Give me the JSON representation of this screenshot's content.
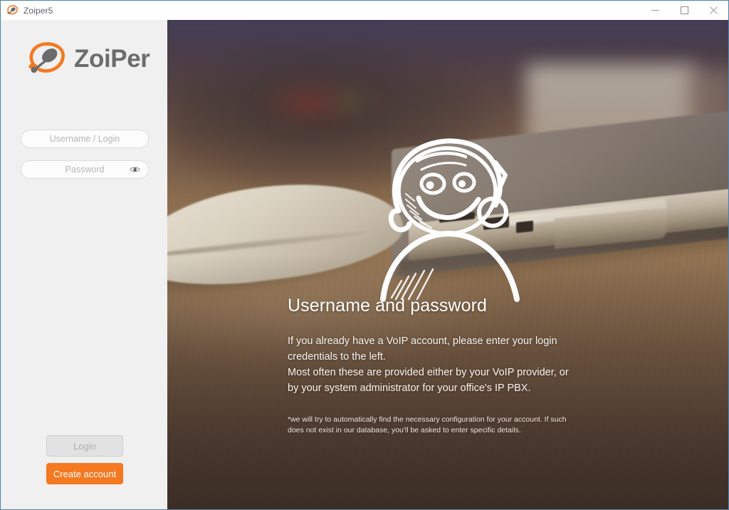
{
  "window": {
    "title": "Zoiper5",
    "app_icon": "zoiper-headset-icon",
    "controls": {
      "minimize": "minimize-icon",
      "maximize": "maximize-icon",
      "close": "close-icon"
    },
    "border_color": "#4a82ab"
  },
  "sidebar": {
    "logo": {
      "text": "ZoiPer",
      "mark": "zoiper-headset-logo",
      "mark_color": "#f47920",
      "text_color": "#6c6c6c"
    },
    "fields": {
      "username": {
        "placeholder": "Username / Login",
        "value": ""
      },
      "password": {
        "placeholder": "Password",
        "value": "",
        "reveal_icon": "eye-icon"
      }
    },
    "buttons": {
      "login": {
        "label": "Login",
        "state": "disabled"
      },
      "create_account": {
        "label": "Create account",
        "color": "#f47920"
      }
    },
    "background_color": "#f0f0f0"
  },
  "hero": {
    "heading": "Username and password",
    "paragraph_lines": [
      "If you already have a VoIP account, please enter your login",
      "credentials to the left.",
      "Most often these are provided either by your VoIP provider, or",
      "by your system administrator for your office's IP PBX."
    ],
    "note_lines": [
      "*we will try to automatically find the necessary configuration for your account. If such does",
      "not exist in our database, you'll be asked to enter specific details."
    ],
    "illustration": "sketch-smiley-headset-icon",
    "background_image": "blurred-desk-laptop-mouse-photo"
  }
}
